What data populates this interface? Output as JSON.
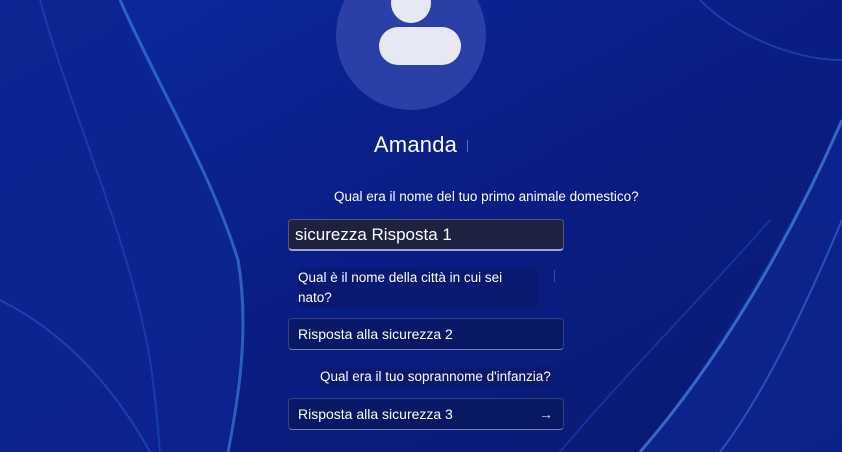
{
  "user": {
    "name": "Amanda"
  },
  "questions": [
    {
      "label": "Qual era il nome del tuo primo animale domestico?",
      "answer_value": "sicurezza Risposta 1"
    },
    {
      "label": "Qual è il nome della città in cui sei nato?",
      "answer_placeholder": "Risposta alla sicurezza 2"
    },
    {
      "label": "Qual era il tuo soprannome d'infanzia?",
      "answer_placeholder": "Risposta alla sicurezza 3"
    }
  ],
  "icons": {
    "avatar": "person-icon",
    "submit": "arrow-right-icon"
  },
  "colors": {
    "background": "#0a1f8a",
    "avatar_circle": "#2a3fa8",
    "avatar_glyph": "#e6e8f4"
  }
}
